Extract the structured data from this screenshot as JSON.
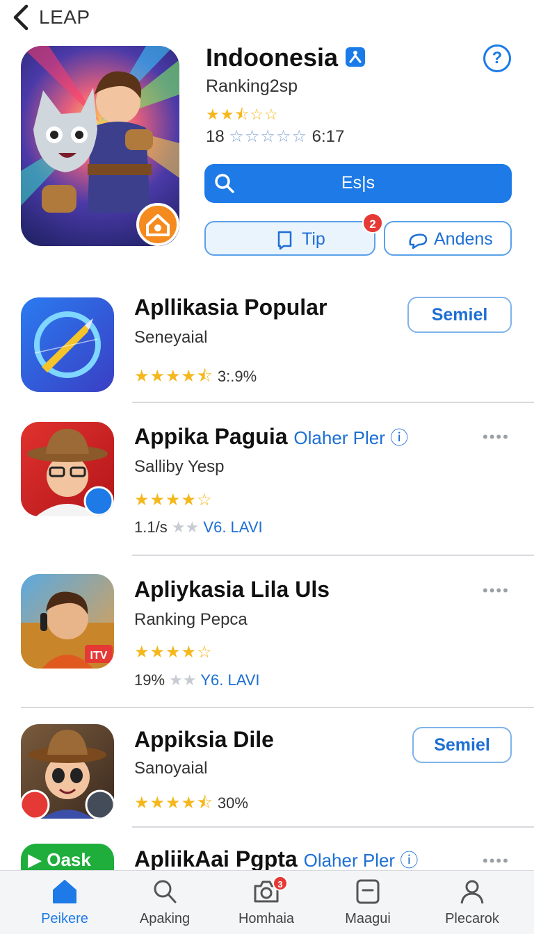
{
  "header": {
    "back_label": "LEAP"
  },
  "hero": {
    "title": "Indoonesia",
    "subtitle": "Ranking2sp",
    "stars": "★★⯪☆☆",
    "meta_prefix": "18",
    "meta_stars": "☆☆☆☆☆",
    "meta_suffix": "6:17",
    "search_label": "Es|s",
    "tip_label": "Tip",
    "tip_badge": "2",
    "andens_label": "Andens"
  },
  "apps": [
    {
      "title": "Apllikasia Popular",
      "extra": "",
      "subtitle": "Seneyaial",
      "stars": "★★★★⯪",
      "rating_text": "3:.9%",
      "line2": "",
      "action": "Semiel"
    },
    {
      "title": "Appika Paguia",
      "extra": "Olaher Pler ⓘ",
      "subtitle": "Salliby Yesp",
      "stars": "★★★★☆",
      "rating_text": "",
      "line2_prefix": "1.1/s",
      "line2_suffix": "V6. LAVI",
      "action": ""
    },
    {
      "title": "Apliykasia Lila Uls",
      "extra": "",
      "subtitle": "Ranking Pepca",
      "stars": "★★★★☆",
      "rating_text": "",
      "line2_prefix": "19%",
      "line2_suffix": "Y6. LAVI",
      "action": ""
    },
    {
      "title": "Appiksia Dile",
      "extra": "",
      "subtitle": "Sanoyaial",
      "stars": "★★★★⯪",
      "rating_text": "30%",
      "line2": "",
      "action": "Semiel"
    },
    {
      "title": "ApliikAai Pgpta",
      "extra": "Olaher Pler ⓘ",
      "icon_text": "▶ Oask",
      "action": ""
    }
  ],
  "more_label": "••••",
  "tabs": [
    {
      "label": "Peikere",
      "active": true
    },
    {
      "label": "Apaking"
    },
    {
      "label": "Homhaia",
      "badge": "3"
    },
    {
      "label": "Maagui"
    },
    {
      "label": "Plecarok"
    }
  ],
  "colors": {
    "accent": "#1d7ae6",
    "star": "#f5b71b",
    "badge": "#e53935"
  }
}
